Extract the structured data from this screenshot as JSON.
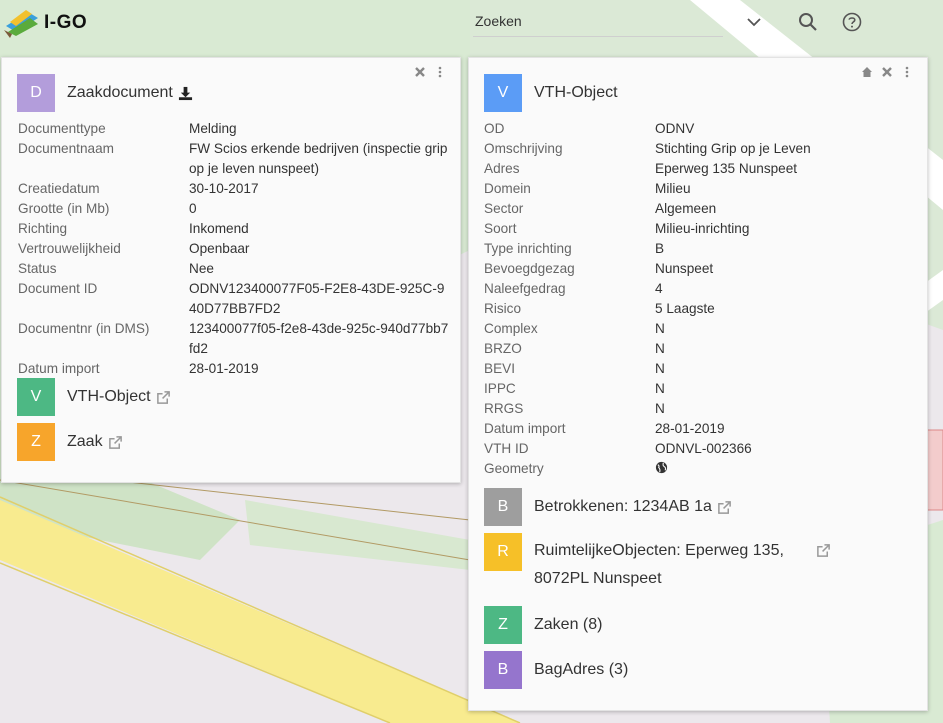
{
  "app": {
    "name": "I-GO"
  },
  "search": {
    "placeholder": "Zoeken"
  },
  "colors": {
    "purple_light": "#b39ddb",
    "blue": "#5b9cf6",
    "green": "#4db884",
    "orange": "#f7a52b",
    "grey": "#9e9e9e",
    "yellow": "#f6c028",
    "purple": "#9575cd"
  },
  "left_panel": {
    "tile_letter": "D",
    "title": "Zaakdocument",
    "fields": [
      {
        "label": "Documenttype",
        "value": "Melding"
      },
      {
        "label": "Documentnaam",
        "value": "FW Scios erkende bedrijven (inspectie grip op je leven nunspeet)"
      },
      {
        "label": "Creatiedatum",
        "value": "30-10-2017"
      },
      {
        "label": "Grootte (in Mb)",
        "value": "0"
      },
      {
        "label": "Richting",
        "value": "Inkomend"
      },
      {
        "label": "Vertrouwelijkheid",
        "value": "Openbaar"
      },
      {
        "label": "Status",
        "value": "Nee"
      },
      {
        "label": "Document ID",
        "value": "ODNV123400077F05-F2E8-43DE-925C-940D77BB7FD2"
      },
      {
        "label": "Documentnr (in DMS)",
        "value": "123400077f05-f2e8-43de-925c-940d77bb7fd2"
      },
      {
        "label": "Datum import",
        "value": "28-01-2019"
      }
    ],
    "relations": [
      {
        "letter": "V",
        "label": "VTH-Object"
      },
      {
        "letter": "Z",
        "label": "Zaak"
      }
    ]
  },
  "right_panel": {
    "tile_letter": "V",
    "title": "VTH-Object",
    "fields": [
      {
        "label": "OD",
        "value": "ODNV"
      },
      {
        "label": "Omschrijving",
        "value": "Stichting Grip op je Leven"
      },
      {
        "label": "Adres",
        "value": "Eperweg 135 Nunspeet"
      },
      {
        "label": "Domein",
        "value": "Milieu"
      },
      {
        "label": "Sector",
        "value": "Algemeen"
      },
      {
        "label": "Soort",
        "value": "Milieu-inrichting"
      },
      {
        "label": "Type inrichting",
        "value": "B"
      },
      {
        "label": "Bevoegdgezag",
        "value": "Nunspeet"
      },
      {
        "label": "Naleefgedrag",
        "value": "4"
      },
      {
        "label": "Risico",
        "value": "5 Laagste"
      },
      {
        "label": "Complex",
        "value": "N"
      },
      {
        "label": "BRZO",
        "value": "N"
      },
      {
        "label": "BEVI",
        "value": "N"
      },
      {
        "label": "IPPC",
        "value": "N"
      },
      {
        "label": "RRGS",
        "value": "N"
      },
      {
        "label": "Datum import",
        "value": "28-01-2019"
      },
      {
        "label": "VTH ID",
        "value": "ODNVL-002366"
      },
      {
        "label": "Geometry",
        "value": ""
      }
    ],
    "relations": [
      {
        "letter": "B",
        "label": "Betrokkenen: 1234AB 1a"
      },
      {
        "letter": "R",
        "label": "RuimtelijkeObjecten: Eperweg 135, 8072PL Nunspeet"
      },
      {
        "letter": "Z",
        "label": "Zaken (8)"
      },
      {
        "letter": "B",
        "label": "BagAdres (3)"
      }
    ]
  }
}
